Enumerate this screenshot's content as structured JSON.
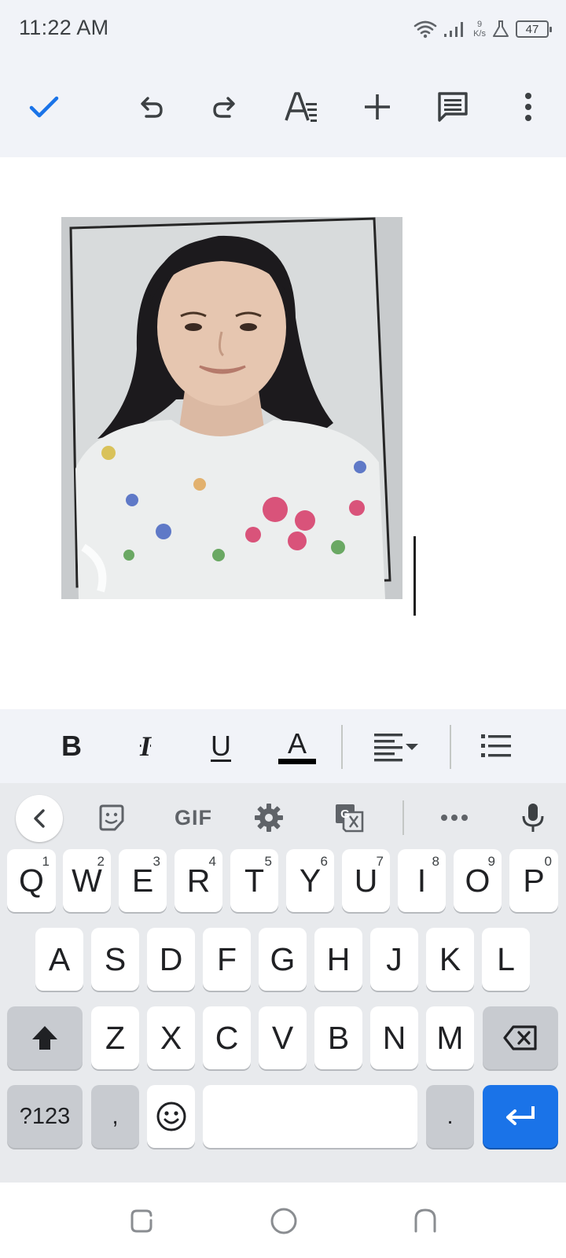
{
  "status_bar": {
    "time": "11:22 AM",
    "net_speed_value": "9",
    "net_speed_unit": "K/s",
    "battery": "47",
    "icons": [
      "wifi-icon",
      "signal-icon",
      "flask-icon",
      "battery-icon"
    ]
  },
  "toolbar": {
    "icons": [
      "check-icon",
      "undo-icon",
      "redo-icon",
      "text-format-icon",
      "insert-icon",
      "comment-icon",
      "more-vert-icon"
    ]
  },
  "document": {
    "content": "inline image of a portrait photo followed by a text cursor"
  },
  "format_bar": {
    "bold_label": "B",
    "italic_label": "I",
    "underline_label": "U",
    "text_color_label": "A",
    "text_color": "#000000",
    "icons": [
      "align-left-icon",
      "dropdown-arrow-icon",
      "bulleted-list-icon"
    ]
  },
  "keyboard": {
    "toolbar": {
      "gif_label": "GIF",
      "icons": [
        "back-arrow-icon",
        "sticker-icon",
        "settings-icon",
        "translate-icon",
        "more-horiz-icon",
        "mic-icon"
      ]
    },
    "row1": [
      {
        "label": "Q",
        "hint": "1"
      },
      {
        "label": "W",
        "hint": "2"
      },
      {
        "label": "E",
        "hint": "3"
      },
      {
        "label": "R",
        "hint": "4"
      },
      {
        "label": "T",
        "hint": "5"
      },
      {
        "label": "Y",
        "hint": "6"
      },
      {
        "label": "U",
        "hint": "7"
      },
      {
        "label": "I",
        "hint": "8"
      },
      {
        "label": "O",
        "hint": "9"
      },
      {
        "label": "P",
        "hint": "0"
      }
    ],
    "row2": [
      "A",
      "S",
      "D",
      "F",
      "G",
      "H",
      "J",
      "K",
      "L"
    ],
    "row3": [
      "Z",
      "X",
      "C",
      "V",
      "B",
      "N",
      "M"
    ],
    "symbols_label": "?123",
    "comma_label": ",",
    "period_label": ".",
    "space_label": "",
    "accent_color": "#1a73e8"
  },
  "navbar": {
    "icons": [
      "recents-icon",
      "home-icon",
      "back-icon"
    ]
  }
}
